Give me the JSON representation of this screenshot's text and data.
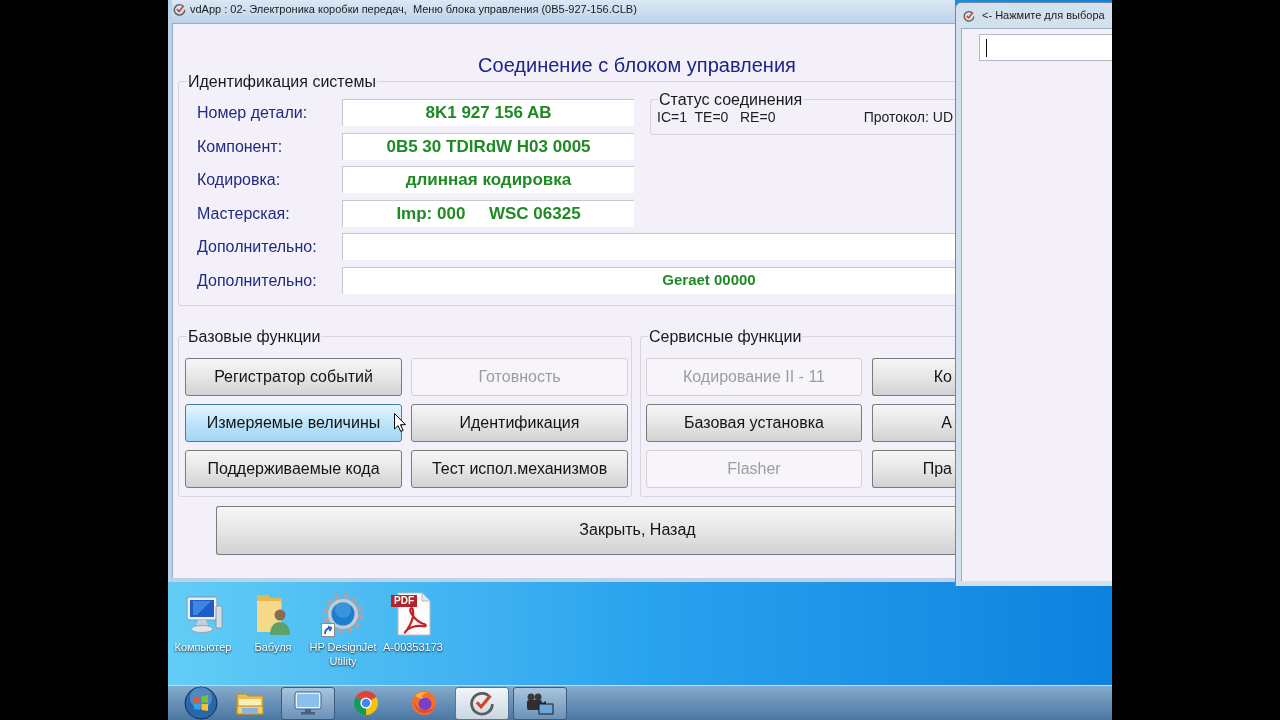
{
  "main_window": {
    "title": "vdApp : 02- Электроника коробки передач,  Меню блока управления (0B5-927-156.CLB)",
    "heading": "Соединение с блоком управления",
    "identification": {
      "title": "Идентификация системы",
      "rows": [
        {
          "kind": "field",
          "label": "Номер детали:",
          "value": "8K1 927 156 AB"
        },
        {
          "kind": "field",
          "label": "Компонент:",
          "value": "0B5 30 TDIRdW H03 0005"
        },
        {
          "kind": "field",
          "label": "Кодировка:",
          "value": "длинная кодировка"
        },
        {
          "kind": "field",
          "label": "Мастерская:",
          "value": "Imp: 000     WSC 06325"
        },
        {
          "kind": "extra",
          "label": "Дополнительно:"
        },
        {
          "kind": "extra",
          "label": "Дополнительно:",
          "value": "Geraet 00000"
        }
      ]
    },
    "connection_status": {
      "title": "Статус соединения",
      "counters": "IC=1  TE=0   RE=0",
      "protocol": "Протокол: UD"
    },
    "basic_functions": {
      "title": "Базовые функции",
      "buttons": [
        {
          "label": "Регистратор событий",
          "disabled": false,
          "hovered": false
        },
        {
          "label": "Готовность",
          "disabled": true,
          "hovered": false
        },
        {
          "label": "Измеряемые величины",
          "disabled": false,
          "hovered": true
        },
        {
          "label": "Идентификация",
          "disabled": false,
          "hovered": false
        },
        {
          "label": "Поддерживаемые кода",
          "disabled": false,
          "hovered": false
        },
        {
          "label": "Тест испол.механизмов",
          "disabled": false,
          "hovered": false
        }
      ]
    },
    "service_functions": {
      "title": "Сервисные функции",
      "buttons": [
        {
          "label": "Кодирование II - 11",
          "disabled": true,
          "hovered": false
        },
        {
          "label": "Ко",
          "disabled": false,
          "hovered": false
        },
        {
          "label": "Базовая установка",
          "disabled": false,
          "hovered": false
        },
        {
          "label": "А",
          "disabled": false,
          "hovered": false
        },
        {
          "label": "Flasher",
          "disabled": true,
          "hovered": false
        },
        {
          "label": "Пра",
          "disabled": false,
          "hovered": false
        }
      ]
    },
    "close_button": "Закрыть, Назад"
  },
  "side_window": {
    "title": "<- Нажмите для выбора",
    "input": {
      "focused": true
    }
  },
  "desktop": {
    "icons": [
      {
        "kind": "computer",
        "label": "Компьютер",
        "shortcut": false
      },
      {
        "kind": "user_folder",
        "label": "Бабуля",
        "shortcut": false
      },
      {
        "kind": "utility",
        "label": "HP DesignJet Utility",
        "shortcut": true
      },
      {
        "kind": "pdf",
        "label": "A-00353173",
        "shortcut": false,
        "badge": "PDF"
      }
    ]
  },
  "taskbar": {
    "items": [
      {
        "kind": "start",
        "running": false,
        "selected": false
      },
      {
        "kind": "folder",
        "running": false,
        "selected": false
      },
      {
        "kind": "monitor",
        "running": true,
        "selected": false
      },
      {
        "kind": "browser",
        "running": false,
        "selected": false
      },
      {
        "kind": "globe",
        "running": false,
        "selected": false
      },
      {
        "kind": "app",
        "running": true,
        "selected": true
      },
      {
        "kind": "camera",
        "running": true,
        "selected": false
      }
    ]
  }
}
